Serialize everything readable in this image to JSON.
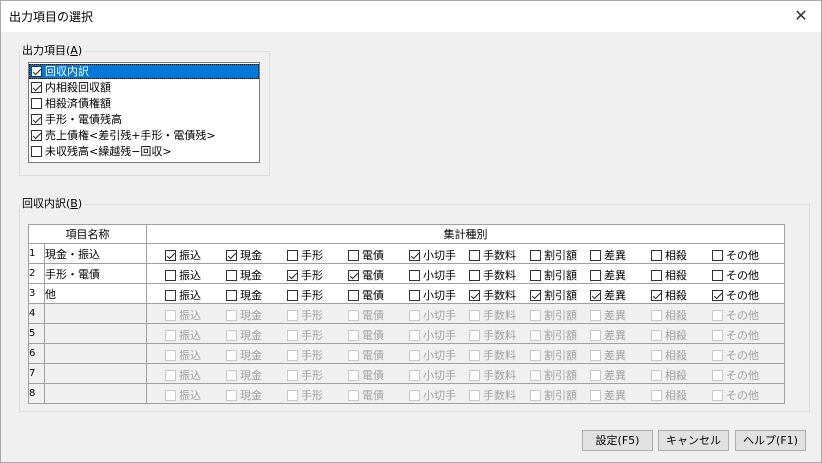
{
  "window": {
    "title": "出力項目の選択",
    "close": "✕"
  },
  "output_group": {
    "label": "出力項目(",
    "access_key": "A",
    "label_end": ")",
    "items": [
      {
        "label": "回収内訳",
        "checked": true,
        "selected": true
      },
      {
        "label": "内相殺回収額",
        "checked": true,
        "selected": false
      },
      {
        "label": "相殺済債権額",
        "checked": false,
        "selected": false
      },
      {
        "label": "手形・電債残高",
        "checked": true,
        "selected": false
      },
      {
        "label": "売上債権<差引残+手形・電債残>",
        "checked": true,
        "selected": false
      },
      {
        "label": "未収残高<繰越残−回収>",
        "checked": false,
        "selected": false
      }
    ]
  },
  "breakdown_group": {
    "label": "回収内訳(",
    "access_key": "B",
    "label_end": ")",
    "columns": {
      "name": "項目名称",
      "types": "集計種別"
    },
    "type_labels": [
      "振込",
      "現金",
      "手形",
      "電債",
      "小切手",
      "手数料",
      "割引額",
      "差異",
      "相殺",
      "その他"
    ],
    "rows": [
      {
        "no": "1",
        "name": "現金・振込",
        "enabled": true,
        "checks": [
          true,
          true,
          false,
          false,
          true,
          false,
          false,
          false,
          false,
          false
        ]
      },
      {
        "no": "2",
        "name": "手形・電債",
        "enabled": true,
        "checks": [
          false,
          false,
          true,
          true,
          false,
          false,
          false,
          false,
          false,
          false
        ]
      },
      {
        "no": "3",
        "name": "他",
        "enabled": true,
        "checks": [
          false,
          false,
          false,
          false,
          false,
          true,
          true,
          true,
          true,
          true
        ]
      },
      {
        "no": "4",
        "name": "",
        "enabled": false,
        "checks": [
          false,
          false,
          false,
          false,
          false,
          false,
          false,
          false,
          false,
          false
        ]
      },
      {
        "no": "5",
        "name": "",
        "enabled": false,
        "checks": [
          false,
          false,
          false,
          false,
          false,
          false,
          false,
          false,
          false,
          false
        ]
      },
      {
        "no": "6",
        "name": "",
        "enabled": false,
        "checks": [
          false,
          false,
          false,
          false,
          false,
          false,
          false,
          false,
          false,
          false
        ]
      },
      {
        "no": "7",
        "name": "",
        "enabled": false,
        "checks": [
          false,
          false,
          false,
          false,
          false,
          false,
          false,
          false,
          false,
          false
        ]
      },
      {
        "no": "8",
        "name": "",
        "enabled": false,
        "checks": [
          false,
          false,
          false,
          false,
          false,
          false,
          false,
          false,
          false,
          false
        ]
      }
    ]
  },
  "buttons": {
    "ok": "設定(F5)",
    "cancel": "キャンセル",
    "help": "ヘルプ(F1)"
  },
  "colors": {
    "selection": "#0078d7",
    "background": "#f0f0f0"
  }
}
